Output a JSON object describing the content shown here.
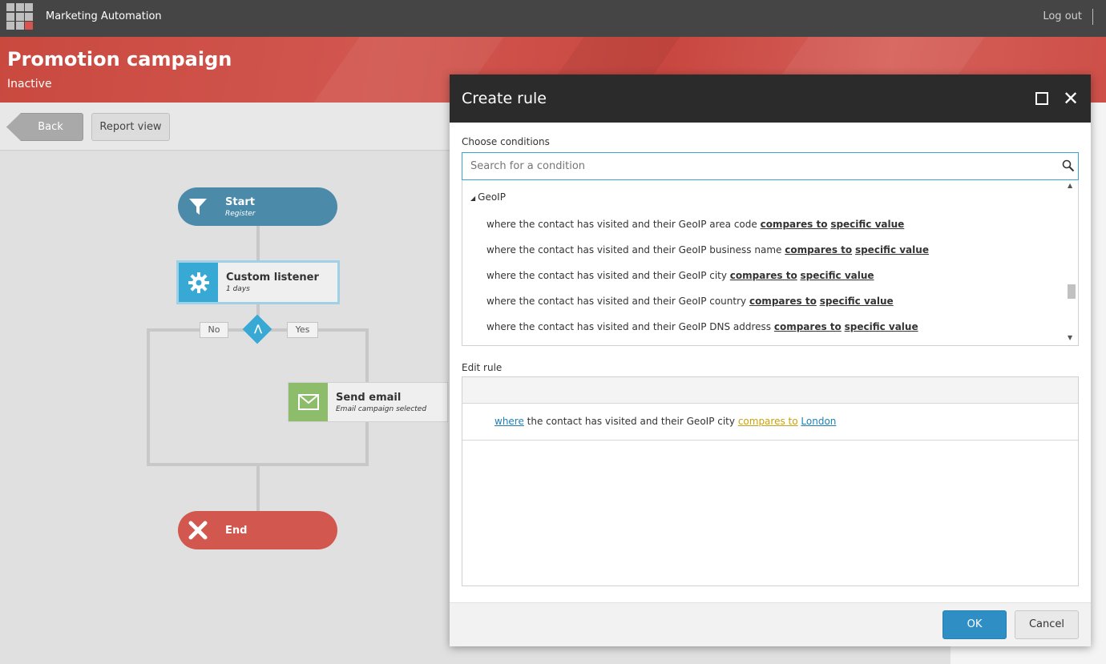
{
  "app": {
    "title": "Marketing Automation",
    "logout": "Log out"
  },
  "header": {
    "title": "Promotion campaign",
    "status": "Inactive"
  },
  "toolbar": {
    "back": "Back",
    "report": "Report view"
  },
  "flow": {
    "start": {
      "title": "Start",
      "subtitle": "Register",
      "icon": "funnel-icon"
    },
    "listener": {
      "title": "Custom listener",
      "subtitle": "1 days",
      "icon": "gear-icon"
    },
    "no_label": "No",
    "yes_label": "Yes",
    "email": {
      "title": "Send email",
      "subtitle": "Email campaign selected",
      "icon": "envelope-icon"
    },
    "end": {
      "title": "End",
      "icon": "close-x-icon"
    }
  },
  "modal": {
    "title": "Create rule",
    "choose_label": "Choose conditions",
    "search_placeholder": "Search for a condition",
    "group": "GeoIP",
    "conditions": [
      {
        "text": "where the contact has visited and their GeoIP area code ",
        "op": "compares to",
        "val": "specific value"
      },
      {
        "text": "where the contact has visited and their GeoIP business name ",
        "op": "compares to",
        "val": "specific value"
      },
      {
        "text": "where the contact has visited and their GeoIP city ",
        "op": "compares to",
        "val": "specific value"
      },
      {
        "text": "where the contact has visited and their GeoIP country ",
        "op": "compares to",
        "val": "specific value"
      },
      {
        "text": "where the contact has visited and their GeoIP DNS address ",
        "op": "compares to",
        "val": "specific value"
      }
    ],
    "edit_label": "Edit rule",
    "rule": {
      "where": "where",
      "text": " the contact has visited and their GeoIP city ",
      "op": "compares to",
      "value": "London"
    },
    "ok": "OK",
    "cancel": "Cancel"
  }
}
